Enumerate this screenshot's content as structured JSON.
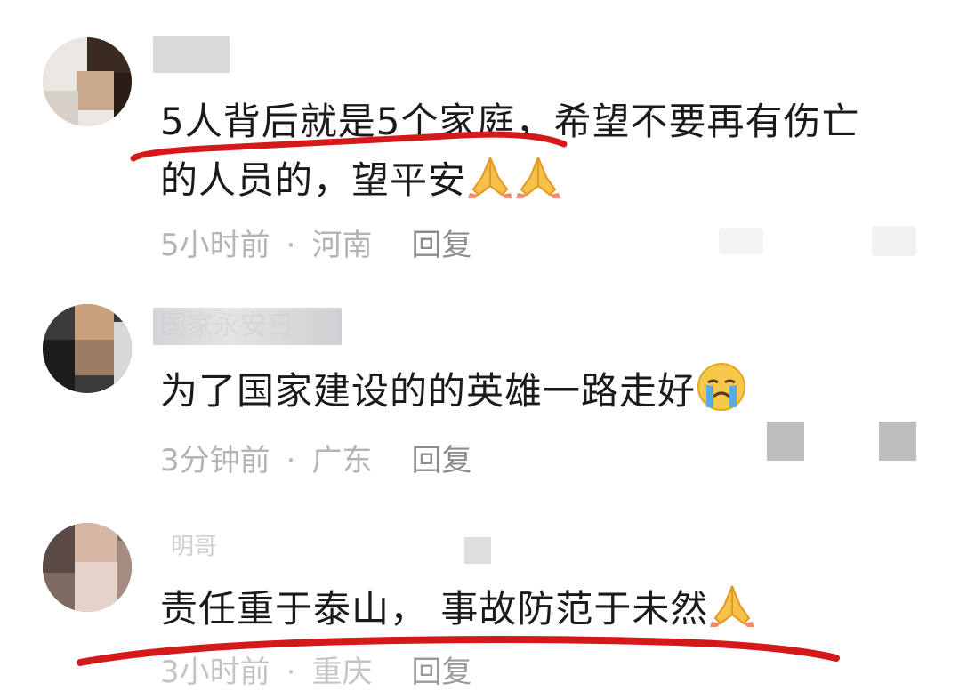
{
  "comments": [
    {
      "username": "",
      "text_line1": "5人背后就是5个家庭，希望不要再有伤亡",
      "text_line2": "的人员的，望平安",
      "emoji": "pray-icon",
      "time": "5小时前",
      "location": "河南",
      "reply_label": "回复"
    },
    {
      "username": "国家永安日",
      "text_line1": "为了国家建设的的英雄一路走好",
      "emoji": "crying-icon",
      "time": "3分钟前",
      "location": "广东",
      "reply_label": "回复"
    },
    {
      "username": "明哥",
      "text_line1": "责任重于泰山， 事故防范于未然",
      "emoji": "pray-icon",
      "time": "3小时前",
      "location": "重庆",
      "reply_label": "回复"
    }
  ],
  "colors": {
    "highlight_underline": "#d4191a",
    "text": "#1a1a1a",
    "meta": "#b4b4b4"
  }
}
